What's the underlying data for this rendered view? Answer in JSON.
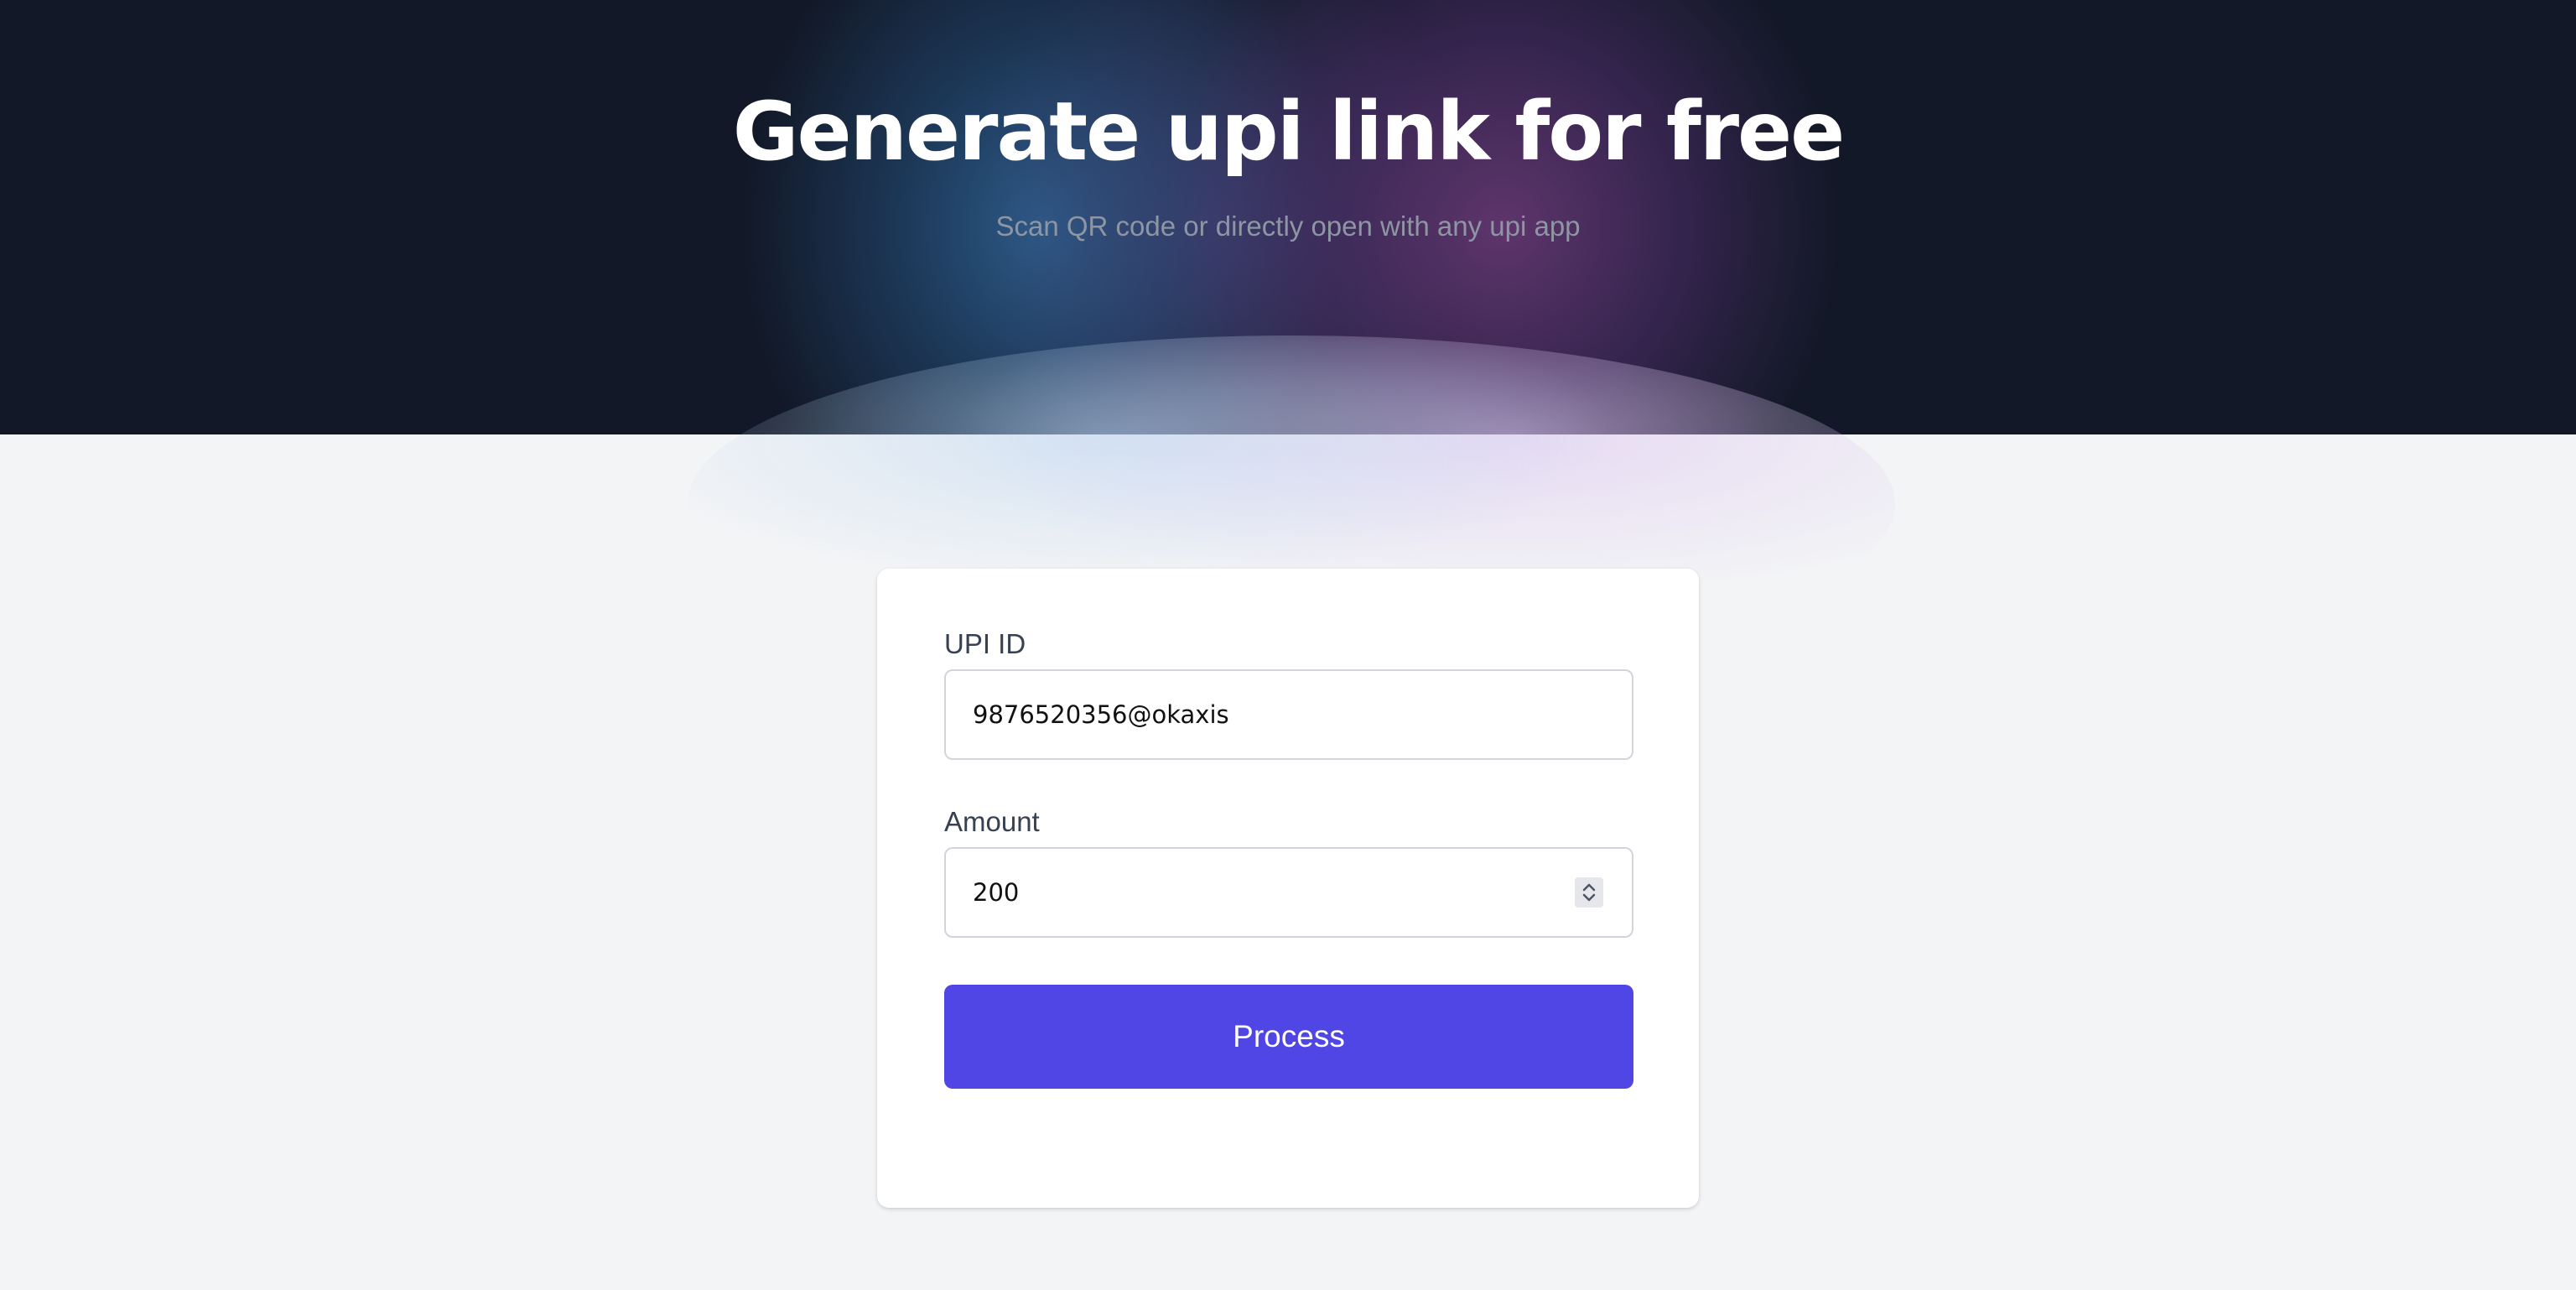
{
  "hero": {
    "title": "Generate upi link for free",
    "subtitle": "Scan QR code or directly open with any upi app"
  },
  "form": {
    "upi_id": {
      "label": "UPI ID",
      "value": "9876520356@okaxis"
    },
    "amount": {
      "label": "Amount",
      "value": "200"
    },
    "submit_label": "Process"
  },
  "colors": {
    "hero_background": "#121827",
    "page_background": "#f3f4f6",
    "button_accent": "#4f46e5"
  },
  "icons": {
    "stepper": "chevron-up-down-icon"
  }
}
